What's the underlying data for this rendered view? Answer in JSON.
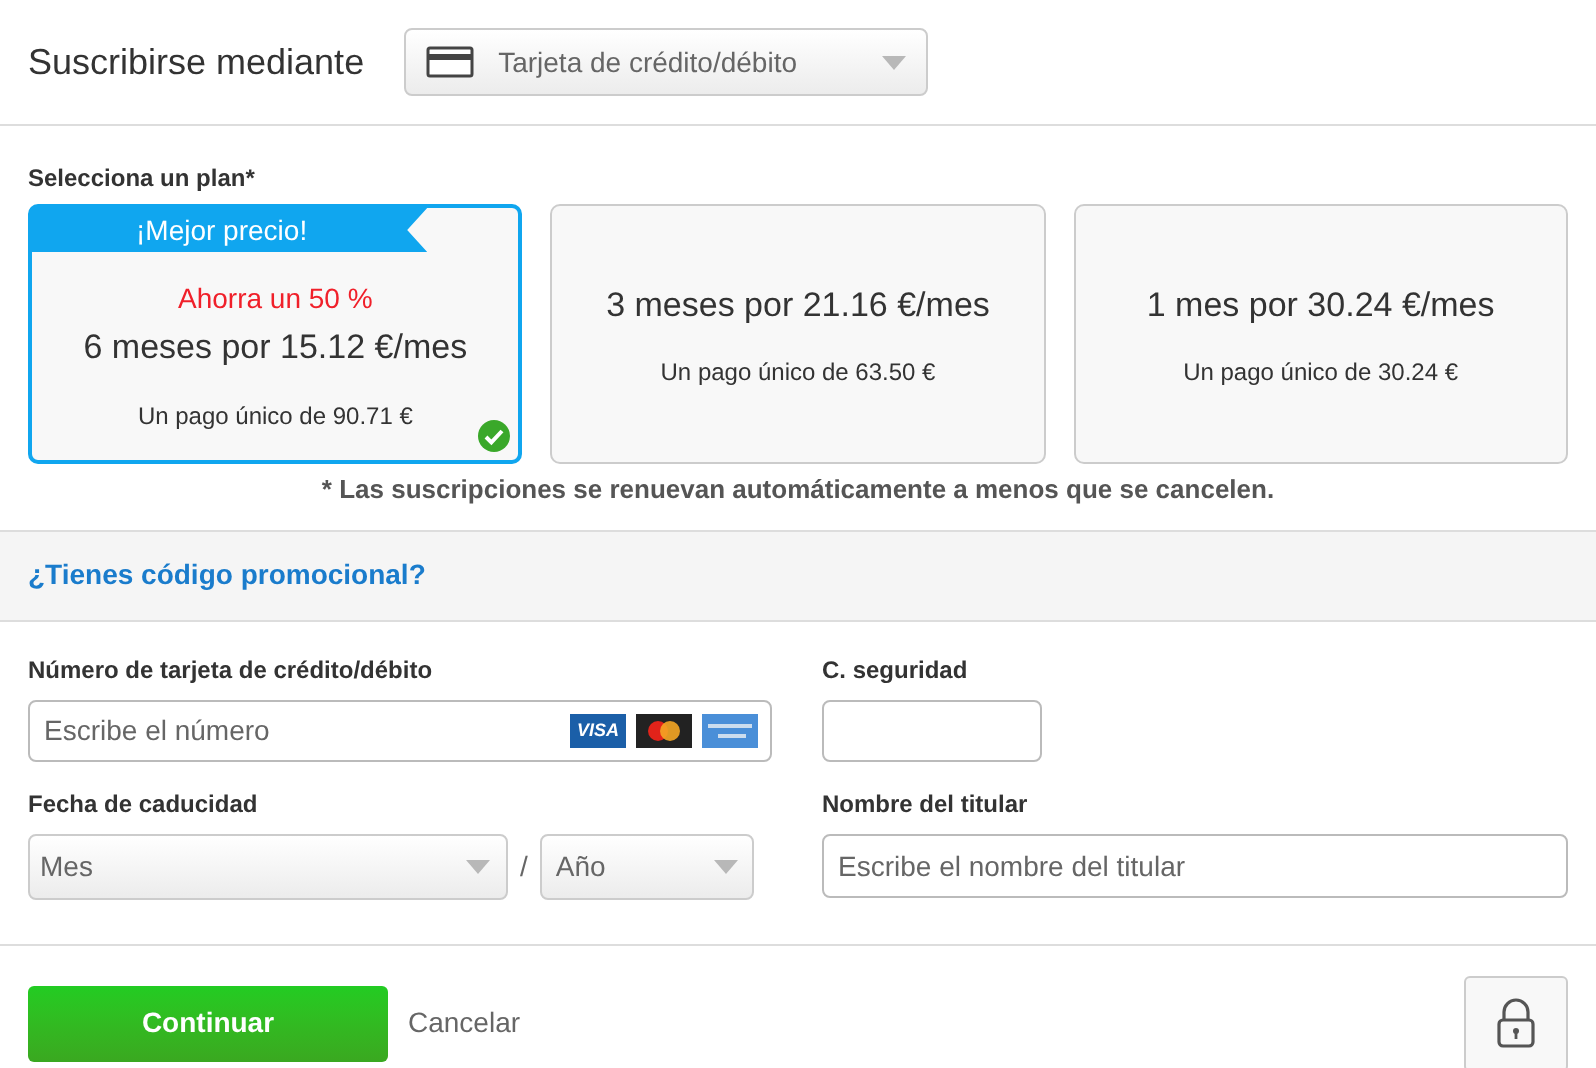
{
  "header": {
    "label": "Suscribirse mediante",
    "method": "Tarjeta de crédito/débito"
  },
  "plan_label": "Selecciona un plan*",
  "plans": [
    {
      "ribbon": "¡Mejor precio!",
      "saving": "Ahorra un 50 %",
      "price": "6 meses por 15.12 €/mes",
      "total": "Un pago único de 90.71 €",
      "selected": true
    },
    {
      "price": "3 meses por 21.16 €/mes",
      "total": "Un pago único de 63.50 €",
      "selected": false
    },
    {
      "price": "1 mes por 30.24 €/mes",
      "total": "Un pago único de 30.24 €",
      "selected": false
    }
  ],
  "note": "* Las suscripciones se renuevan automáticamente a menos que se cancelen.",
  "promo_link": "¿Tienes código promocional?",
  "form": {
    "card_number": {
      "label": "Número de tarjeta de crédito/débito",
      "placeholder": "Escribe el número",
      "visa": "VISA"
    },
    "security": {
      "label": "C. seguridad"
    },
    "expiry": {
      "label": "Fecha de caducidad",
      "month": "Mes",
      "separator": "/",
      "year": "Año"
    },
    "holder": {
      "label": "Nombre del titular",
      "placeholder": "Escribe el nombre del titular"
    }
  },
  "actions": {
    "continue": "Continuar",
    "cancel": "Cancelar"
  }
}
